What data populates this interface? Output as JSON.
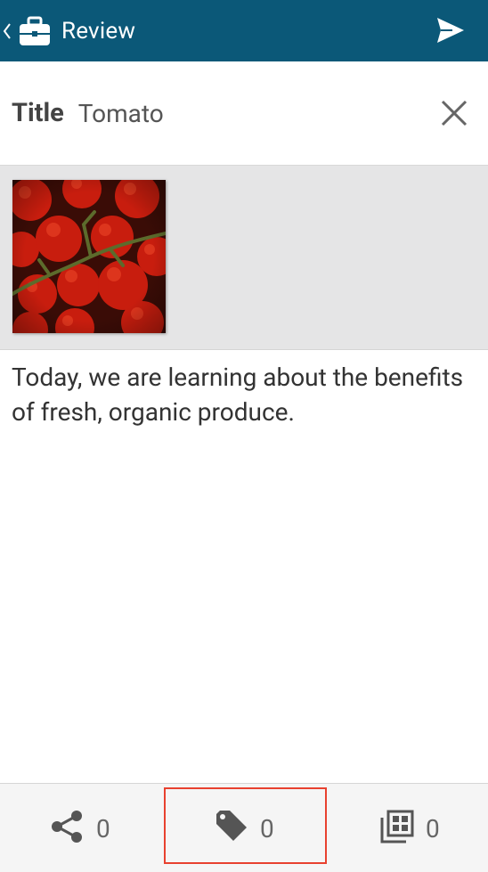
{
  "appbar": {
    "title": "Review",
    "background": "#0b5878",
    "icons": [
      "chevron-left-icon",
      "briefcase-icon",
      "send-icon"
    ]
  },
  "title_row": {
    "label": "Title",
    "value": "Tomato",
    "close_icon": "close-icon"
  },
  "media": {
    "thumbnail_alt": "Tomato photo"
  },
  "content": {
    "text": "Today, we are learning about the benefits of fresh, organic produce."
  },
  "bottom_bar": {
    "share": {
      "icon": "share-icon",
      "count": "0"
    },
    "tags": {
      "icon": "tag-icon",
      "count": "0",
      "highlighted": true
    },
    "gallery": {
      "icon": "gallery-icon",
      "count": "0"
    },
    "highlight_color": "#e8412f"
  }
}
